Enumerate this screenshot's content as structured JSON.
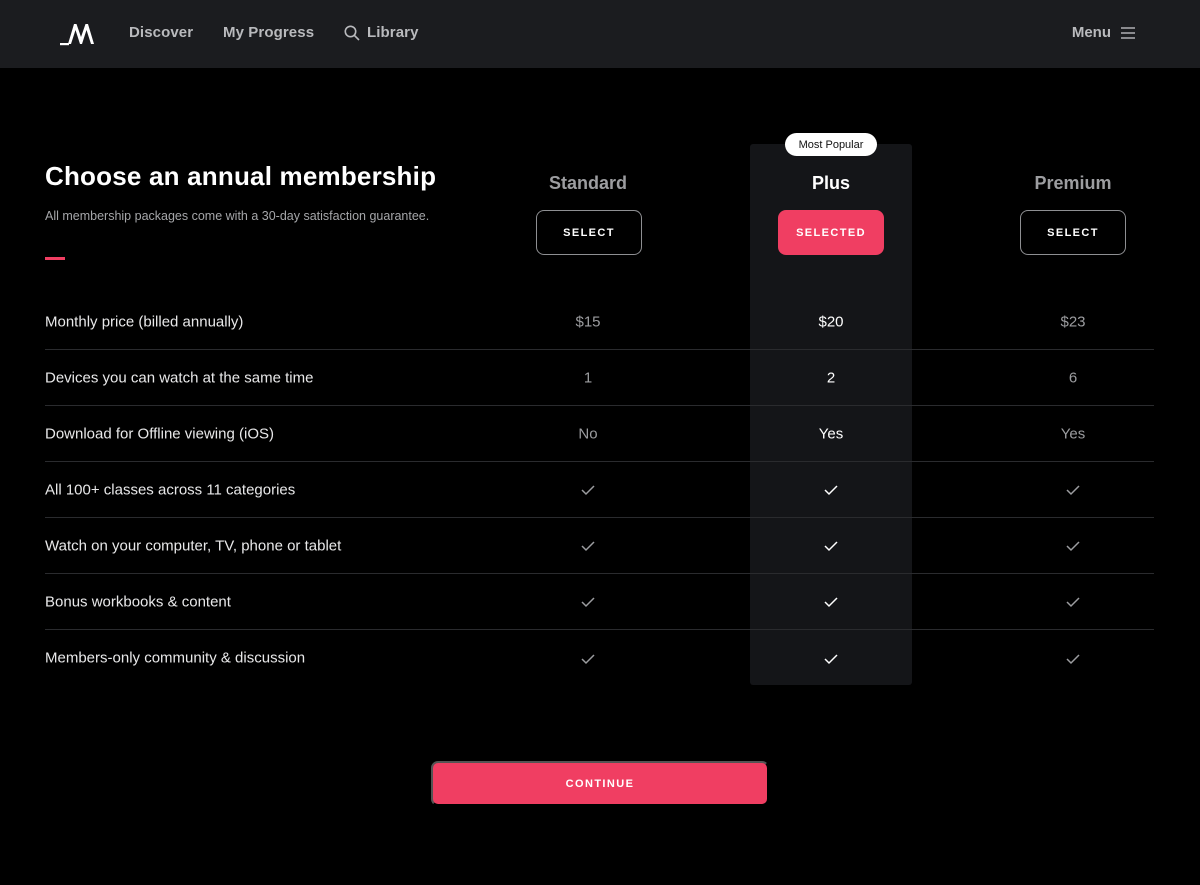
{
  "nav": {
    "logo": "MasterClass",
    "links": [
      "Discover",
      "My Progress",
      "Library"
    ],
    "menu_label": "Menu"
  },
  "header": {
    "title": "Choose an annual membership",
    "subtitle": "All membership packages come with a 30-day satisfaction guarantee."
  },
  "badge": "Most Popular",
  "plans": [
    {
      "name": "Standard",
      "button": "SELECT",
      "selected": false
    },
    {
      "name": "Plus",
      "button": "SELECTED",
      "selected": true
    },
    {
      "name": "Premium",
      "button": "SELECT",
      "selected": false
    }
  ],
  "rows": [
    {
      "label": "Monthly price (billed annually)",
      "values": [
        "$15",
        "$20",
        "$23"
      ]
    },
    {
      "label": "Devices you can watch at the same time",
      "values": [
        "1",
        "2",
        "6"
      ]
    },
    {
      "label": "Download for Offline viewing (iOS)",
      "values": [
        "No",
        "Yes",
        "Yes"
      ]
    },
    {
      "label": "All 100+ classes across 11 categories",
      "values": [
        "check",
        "check",
        "check"
      ]
    },
    {
      "label": "Watch on your computer, TV, phone or tablet",
      "values": [
        "check",
        "check",
        "check"
      ]
    },
    {
      "label": "Bonus workbooks & content",
      "values": [
        "check",
        "check",
        "check"
      ]
    },
    {
      "label": "Members-only community & discussion",
      "values": [
        "check",
        "check",
        "check"
      ]
    }
  ],
  "continue_label": "CONTINUE",
  "colors": {
    "accent": "#f03e62",
    "background": "#000000",
    "nav_bg": "#1b1c1f",
    "highlight_col": "#141518"
  }
}
